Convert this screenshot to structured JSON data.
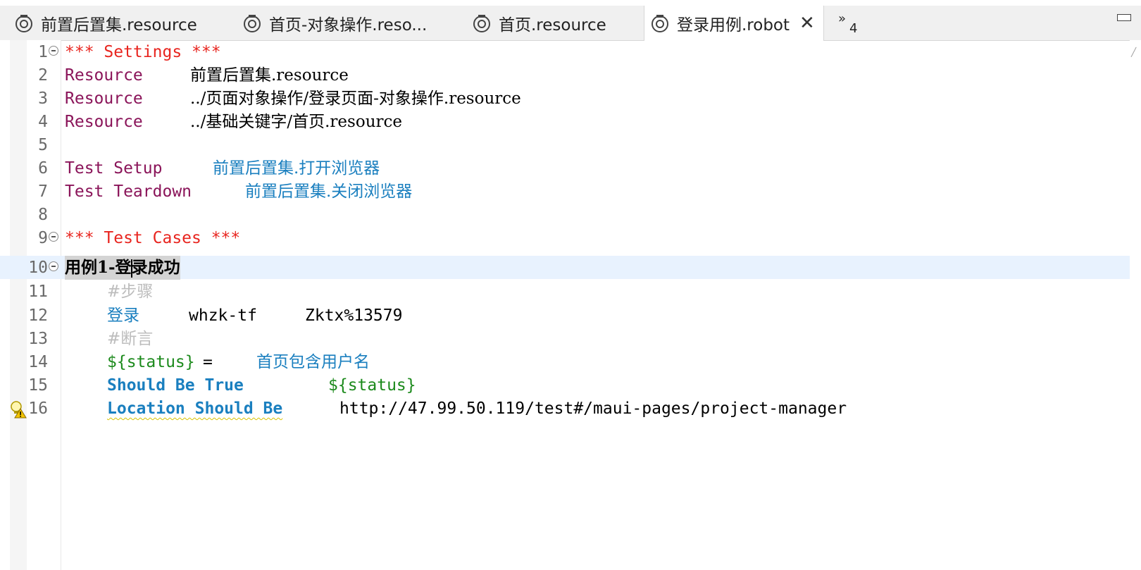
{
  "tabs": [
    {
      "label": "前置后置集.resource",
      "active": false,
      "icon": "robot-file-icon"
    },
    {
      "label": "首页-对象操作.reso...",
      "active": false,
      "icon": "robot-file-icon"
    },
    {
      "label": "首页.resource",
      "active": false,
      "icon": "robot-file-icon"
    },
    {
      "label": "登录用例.robot",
      "active": true,
      "icon": "robot-file-icon"
    }
  ],
  "overflow": {
    "chevron": "»",
    "count": "4"
  },
  "colors": {
    "section": "#e8251f",
    "setting": "#8a1459",
    "keyword": "#1a7fbf",
    "variable": "#1c8a1c",
    "comment": "#bdbdbd",
    "current_line": "#e8f2fe"
  },
  "lines": [
    {
      "num": "1",
      "fold": true
    },
    {
      "num": "2"
    },
    {
      "num": "3"
    },
    {
      "num": "4"
    },
    {
      "num": "5"
    },
    {
      "num": "6"
    },
    {
      "num": "7"
    },
    {
      "num": "8"
    },
    {
      "num": "9",
      "fold": true
    },
    {
      "num": "10",
      "fold": true,
      "current": true
    },
    {
      "num": "11"
    },
    {
      "num": "12"
    },
    {
      "num": "13"
    },
    {
      "num": "14"
    },
    {
      "num": "15"
    },
    {
      "num": "16",
      "warning": true
    }
  ],
  "code": {
    "l1": "*** Settings ***",
    "l2_key": "Resource",
    "l2_val": "前置后置集.resource",
    "l3_key": "Resource",
    "l3_val": "../页面对象操作/登录页面-对象操作.resource",
    "l4_key": "Resource",
    "l4_val": "../基础关键字/首页.resource",
    "l6_key": "Test Setup",
    "l6_val": "前置后置集.打开浏览器",
    "l7_key": "Test Teardown",
    "l7_val": "前置后置集.关闭浏览器",
    "l9": "*** Test Cases ***",
    "l10_a": "用例1-登",
    "l10_b": "录成功",
    "l11": "#步骤",
    "l12_kw": "登录",
    "l12_arg1": "whzk-tf",
    "l12_arg2": "Zktx%13579",
    "l13": "#断言",
    "l14_var": "${status}",
    "l14_eq": "=",
    "l14_kw": "首页包含用户名",
    "l15_kw": "Should Be True",
    "l15_arg": "${status}",
    "l16_kw": "Location Should Be",
    "l16_arg": "http://47.99.50.119/test#/maui-pages/project-manager"
  }
}
